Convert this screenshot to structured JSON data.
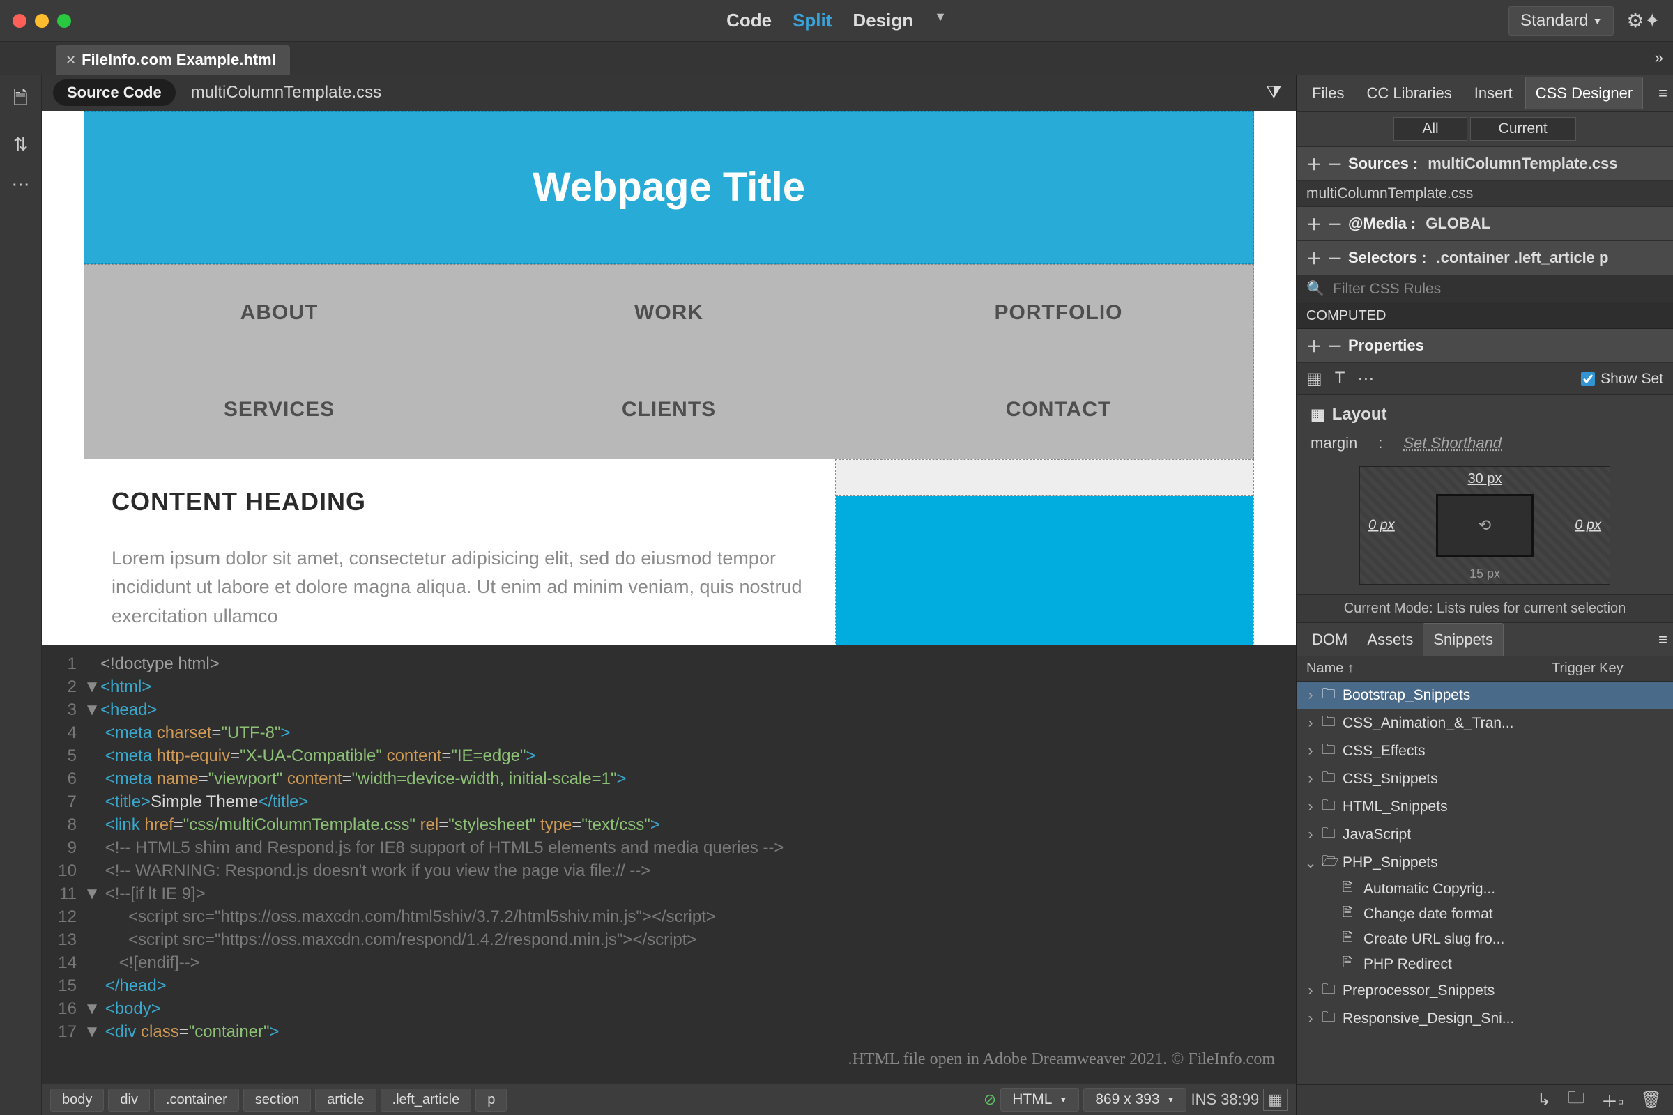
{
  "traffic": {
    "close": "#ff5f57",
    "min": "#febc2e",
    "max": "#28c840"
  },
  "viewModes": {
    "code": "Code",
    "split": "Split",
    "design": "Design"
  },
  "workspace": "Standard",
  "docTab": "FileInfo.com Example.html",
  "sourceBar": {
    "label": "Source Code",
    "file": "multiColumnTemplate.css"
  },
  "preview": {
    "title": "Webpage Title",
    "nav": [
      "ABOUT",
      "WORK",
      "PORTFOLIO",
      "SERVICES",
      "CLIENTS",
      "CONTACT"
    ],
    "heading": "CONTENT HEADING",
    "para": "Lorem ipsum dolor sit amet, consectetur adipisicing elit, sed do eiusmod tempor incididunt ut labore et dolore magna aliqua. Ut enim ad minim veniam, quis nostrud exercitation ullamco"
  },
  "code": {
    "lines": [
      {
        "n": 1,
        "fold": "",
        "html": "<span class='t-doctype'>&lt;!doctype html&gt;</span>"
      },
      {
        "n": 2,
        "fold": "▼",
        "html": "<span class='t-tag'>&lt;html&gt;</span>"
      },
      {
        "n": 3,
        "fold": "▼",
        "html": "<span class='t-tag'>&lt;head&gt;</span>"
      },
      {
        "n": 4,
        "fold": "",
        "html": " <span class='t-tag'>&lt;meta</span> <span class='t-attr'>charset</span><span class='t-eq'>=</span><span class='t-str'>\"UTF-8\"</span><span class='t-tag'>&gt;</span>"
      },
      {
        "n": 5,
        "fold": "",
        "html": " <span class='t-tag'>&lt;meta</span> <span class='t-attr'>http-equiv</span><span class='t-eq'>=</span><span class='t-str'>\"X-UA-Compatible\"</span> <span class='t-attr'>content</span><span class='t-eq'>=</span><span class='t-str'>\"IE=edge\"</span><span class='t-tag'>&gt;</span>"
      },
      {
        "n": 6,
        "fold": "",
        "html": " <span class='t-tag'>&lt;meta</span> <span class='t-attr'>name</span><span class='t-eq'>=</span><span class='t-str'>\"viewport\"</span> <span class='t-attr'>content</span><span class='t-eq'>=</span><span class='t-str'>\"width=device-width, initial-scale=1\"</span><span class='t-tag'>&gt;</span>"
      },
      {
        "n": 7,
        "fold": "",
        "html": " <span class='t-tag'>&lt;title&gt;</span><span class='t-txt'>Simple Theme</span><span class='t-tag'>&lt;/title&gt;</span>"
      },
      {
        "n": 8,
        "fold": "",
        "html": " <span class='t-tag'>&lt;link</span> <span class='t-attr'>href</span><span class='t-eq'>=</span><span class='t-str'>\"css/multiColumnTemplate.css\"</span> <span class='t-attr'>rel</span><span class='t-eq'>=</span><span class='t-str'>\"stylesheet\"</span> <span class='t-attr'>type</span><span class='t-eq'>=</span><span class='t-str'>\"text/css\"</span><span class='t-tag'>&gt;</span>"
      },
      {
        "n": 9,
        "fold": "",
        "html": " <span class='t-com'>&lt;!-- HTML5 shim and Respond.js for IE8 support of HTML5 elements and media queries --&gt;</span>"
      },
      {
        "n": 10,
        "fold": "",
        "html": " <span class='t-com'>&lt;!-- WARNING: Respond.js doesn't work if you view the page via file:// --&gt;</span>"
      },
      {
        "n": 11,
        "fold": "▼",
        "html": " <span class='t-com'>&lt;!--[if lt IE 9]&gt;</span>"
      },
      {
        "n": 12,
        "fold": "",
        "html": "      <span class='t-com'>&lt;script src=\"https://oss.maxcdn.com/html5shiv/3.7.2/html5shiv.min.js\"&gt;&lt;/script&gt;</span>"
      },
      {
        "n": 13,
        "fold": "",
        "html": "      <span class='t-com'>&lt;script src=\"https://oss.maxcdn.com/respond/1.4.2/respond.min.js\"&gt;&lt;/script&gt;</span>"
      },
      {
        "n": 14,
        "fold": "",
        "html": "    <span class='t-com'>&lt;![endif]--&gt;</span>"
      },
      {
        "n": 15,
        "fold": "",
        "html": " <span class='t-tag'>&lt;/head&gt;</span>"
      },
      {
        "n": 16,
        "fold": "▼",
        "html": " <span class='t-tag'>&lt;body&gt;</span>"
      },
      {
        "n": 17,
        "fold": "▼",
        "html": " <span class='t-tag'>&lt;div</span> <span class='t-attr'>class</span><span class='t-eq'>=</span><span class='t-str'>\"container\"</span><span class='t-tag'>&gt;</span>"
      }
    ],
    "overlay": ".HTML file open in Adobe Dreamweaver 2021. © FileInfo.com"
  },
  "status": {
    "crumbs": [
      "body",
      "div",
      ".container",
      "section",
      "article",
      ".left_article",
      "p"
    ],
    "lang": "HTML",
    "dims": "869 x 393",
    "ins": "INS",
    "pos": "38:99"
  },
  "cssDesigner": {
    "tabs": [
      "Files",
      "CC Libraries",
      "Insert",
      "CSS Designer"
    ],
    "filterAll": "All",
    "filterCurrent": "Current",
    "sources": {
      "label": "Sources :",
      "value": "multiColumnTemplate.css",
      "item": "multiColumnTemplate.css"
    },
    "media": {
      "label": "@Media :",
      "value": "GLOBAL"
    },
    "selectors": {
      "label": "Selectors :",
      "value": ".container .left_article p"
    },
    "searchPlaceholder": "Filter CSS Rules",
    "computed": "COMPUTED",
    "properties": "Properties",
    "showSet": "Show Set",
    "layout": "Layout",
    "marginLabel": "margin",
    "shorthand": "Set Shorthand",
    "box": {
      "top": "30 px",
      "left": "0 px",
      "right": "0 px",
      "bottom": "15 px"
    },
    "modeHint": "Current Mode: Lists rules for current selection"
  },
  "snippets": {
    "tabs": [
      "DOM",
      "Assets",
      "Snippets"
    ],
    "cols": {
      "name": "Name ↑",
      "trigger": "Trigger Key"
    },
    "tree": [
      {
        "depth": 0,
        "arrow": "›",
        "ic": "folder",
        "label": "Bootstrap_Snippets",
        "sel": true
      },
      {
        "depth": 0,
        "arrow": "›",
        "ic": "folder",
        "label": "CSS_Animation_&_Tran..."
      },
      {
        "depth": 0,
        "arrow": "›",
        "ic": "folder",
        "label": "CSS_Effects"
      },
      {
        "depth": 0,
        "arrow": "›",
        "ic": "folder",
        "label": "CSS_Snippets"
      },
      {
        "depth": 0,
        "arrow": "›",
        "ic": "folder",
        "label": "HTML_Snippets"
      },
      {
        "depth": 0,
        "arrow": "›",
        "ic": "folder",
        "label": "JavaScript"
      },
      {
        "depth": 0,
        "arrow": "⌄",
        "ic": "folder-open",
        "label": "PHP_Snippets"
      },
      {
        "depth": 1,
        "arrow": "",
        "ic": "file",
        "label": "Automatic Copyrig..."
      },
      {
        "depth": 1,
        "arrow": "",
        "ic": "file",
        "label": "Change date format"
      },
      {
        "depth": 1,
        "arrow": "",
        "ic": "file",
        "label": "Create URL slug fro..."
      },
      {
        "depth": 1,
        "arrow": "",
        "ic": "file",
        "label": "PHP Redirect"
      },
      {
        "depth": 0,
        "arrow": "›",
        "ic": "folder",
        "label": "Preprocessor_Snippets"
      },
      {
        "depth": 0,
        "arrow": "›",
        "ic": "folder",
        "label": "Responsive_Design_Sni..."
      }
    ]
  }
}
